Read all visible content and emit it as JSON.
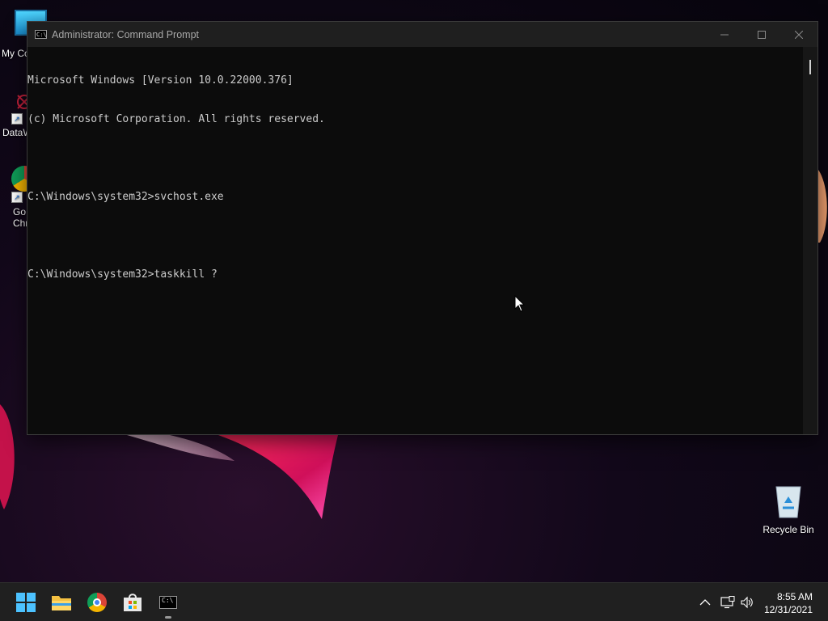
{
  "desktop": {
    "icons": [
      {
        "label": "My Co",
        "icon": "monitor-icon"
      },
      {
        "label": "DataW",
        "icon": "datawarehouse-icon"
      },
      {
        "label": "Go\nChr",
        "icon": "chrome-icon"
      },
      {
        "label": "Recycle Bin",
        "icon": "recycle-bin-icon"
      }
    ]
  },
  "window": {
    "title": "Administrator: Command Prompt",
    "controls": {
      "minimize": "minimize-icon",
      "maximize": "maximize-icon",
      "close": "close-icon"
    }
  },
  "console": {
    "lines": [
      "Microsoft Windows [Version 10.0.22000.376]",
      "(c) Microsoft Corporation. All rights reserved.",
      "",
      "C:\\Windows\\system32>svchost.exe",
      "",
      "C:\\Windows\\system32>taskkill ?"
    ]
  },
  "taskbar": {
    "items": [
      "start-icon",
      "file-explorer-icon",
      "chrome-icon",
      "store-icon",
      "cmd-icon"
    ],
    "tray": [
      "chevron-up-icon",
      "network-icon",
      "volume-icon"
    ],
    "clock": {
      "time": "8:55 AM",
      "date": "12/31/2021"
    }
  },
  "colors": {
    "console_bg": "#0c0c0c",
    "console_text": "#cccccc",
    "titlebar": "#1f1f1f",
    "taskbar": "#202020"
  }
}
